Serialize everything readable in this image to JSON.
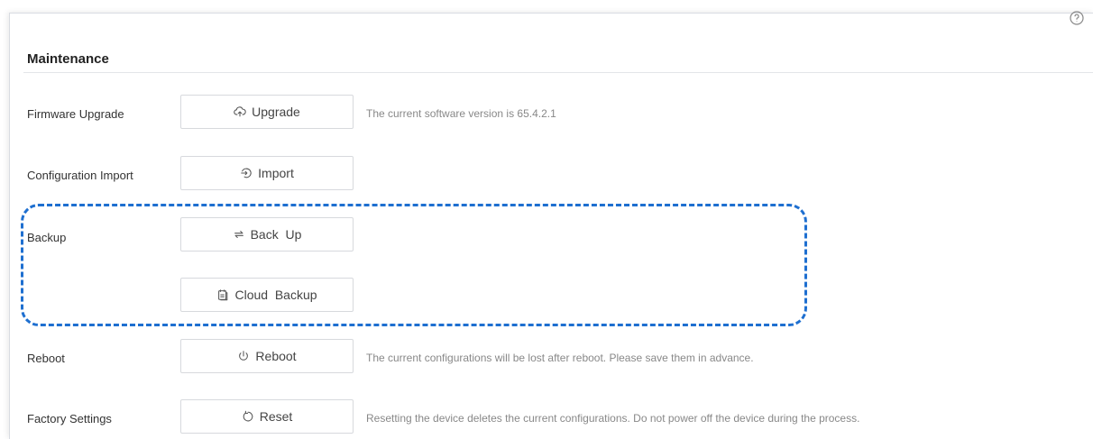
{
  "section": {
    "title": "Maintenance"
  },
  "rows": {
    "firmware": {
      "label": "Firmware Upgrade",
      "button": "Upgrade",
      "description": "The current software version is 65.4.2.1"
    },
    "config_import": {
      "label": "Configuration Import",
      "button": "Import"
    },
    "backup": {
      "label": "Backup",
      "button": "Back  Up",
      "cloud_button": "Cloud  Backup"
    },
    "reboot": {
      "label": "Reboot",
      "button": "Reboot",
      "description": "The current configurations will be lost after reboot. Please save them in advance."
    },
    "factory": {
      "label": "Factory Settings",
      "button": "Reset",
      "description": "Resetting the device deletes the current configurations. Do not power off the device during the process."
    }
  },
  "icons": {
    "help": "help-circle-icon",
    "upgrade": "cloud-upload-icon",
    "import": "import-icon",
    "backup": "sync-icon",
    "cloud_backup": "cloud-backup-icon",
    "reboot": "power-icon",
    "reset": "refresh-icon"
  },
  "colors": {
    "highlight_border": "#1e6fd0",
    "description_text": "#888888"
  }
}
